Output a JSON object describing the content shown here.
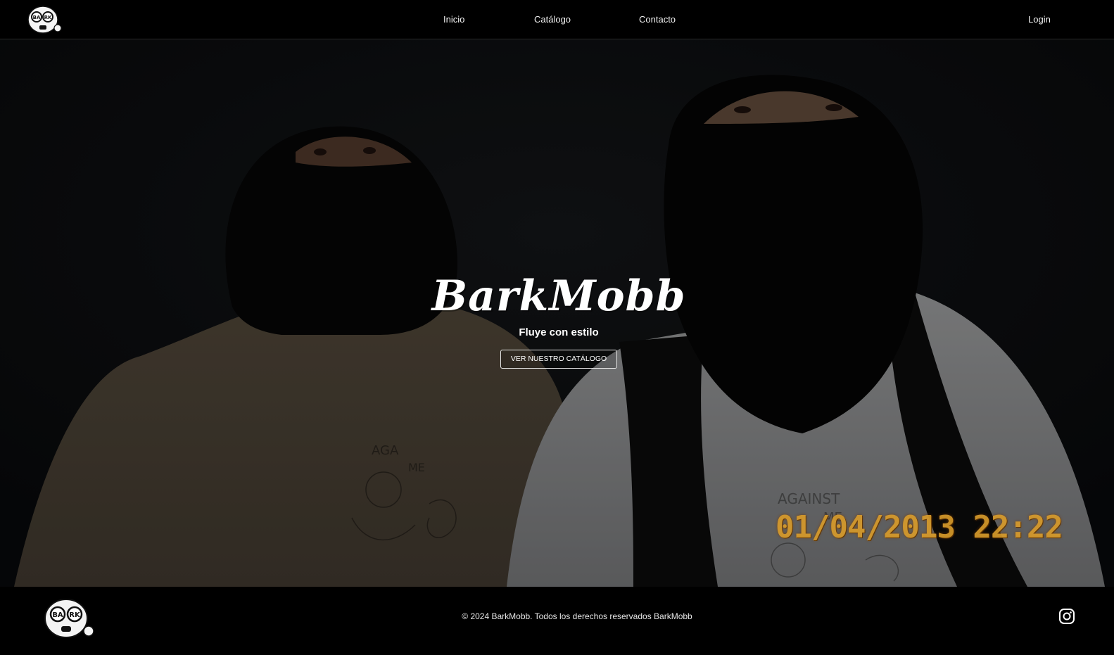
{
  "brand": {
    "name": "BarkMobb",
    "logo_icon": "cartoon-mascot-logo"
  },
  "nav": {
    "items": [
      {
        "label": "Inicio"
      },
      {
        "label": "Catálogo"
      },
      {
        "label": "Contacto"
      }
    ],
    "login_label": "Login"
  },
  "hero": {
    "title": "BarkMobb",
    "subtitle": "Fluye con estilo",
    "cta_label": "VER NUESTRO CATÁLOGO",
    "photo_timestamp": "01/04/2013  22:22",
    "photo_shirt_text": "AGAINST ME"
  },
  "footer": {
    "copyright": "© 2024 BarkMobb. Todos los derechos reservados BarkMobb",
    "social_icon": "instagram-icon"
  },
  "colors": {
    "background": "#000000",
    "text": "#ffffff",
    "timestamp": "#d79a2a"
  }
}
